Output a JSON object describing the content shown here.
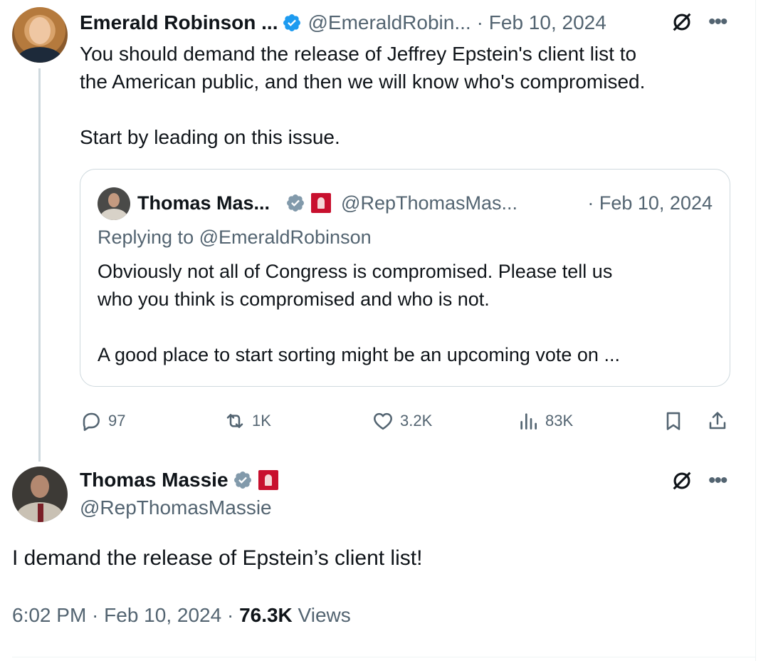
{
  "tweet1": {
    "name": "Emerald Robinson ...",
    "handle": "@EmeraldRobin...",
    "date": "· Feb 10, 2024",
    "body_lines": [
      "You should demand the release of Jeffrey Epstein's client list to",
      "the American public, and then we will know who's compromised."
    ],
    "body_line3": "Start by leading on this issue.",
    "quote": {
      "name": "Thomas Mas...",
      "handle": "@RepThomasMas...",
      "date": "· Feb 10, 2024",
      "reply_to": "Replying to @EmeraldRobinson",
      "body_lines": [
        "Obviously not all of Congress is compromised. Please tell us",
        "who you think is compromised and who is not."
      ],
      "body_line3": "A good place to start sorting might be an upcoming vote on ..."
    },
    "actions": {
      "replies": "97",
      "reposts": "1K",
      "likes": "3.2K",
      "views": "83K"
    }
  },
  "tweet2": {
    "name": "Thomas Massie",
    "handle": "@RepThomasMassie",
    "body": "I demand the release of Epstein’s client list!",
    "timestamp": "6:02 PM · Feb 10, 2024 · ",
    "views_count": "76.3K",
    "views_label": " Views"
  },
  "icons": {
    "verified": "verified-badge-icon",
    "congress": "congress-flag-icon",
    "grok": "slash-circle-icon",
    "more": "more-icon",
    "reply": "reply-icon",
    "repost": "repost-icon",
    "like": "heart-icon",
    "views": "views-icon",
    "bookmark": "bookmark-icon",
    "share": "share-icon"
  },
  "colors": {
    "accent": "#1d9bf0",
    "muted": "#536471",
    "text": "#0f1419",
    "border": "#cfd9de",
    "congress_red": "#c8102e"
  }
}
